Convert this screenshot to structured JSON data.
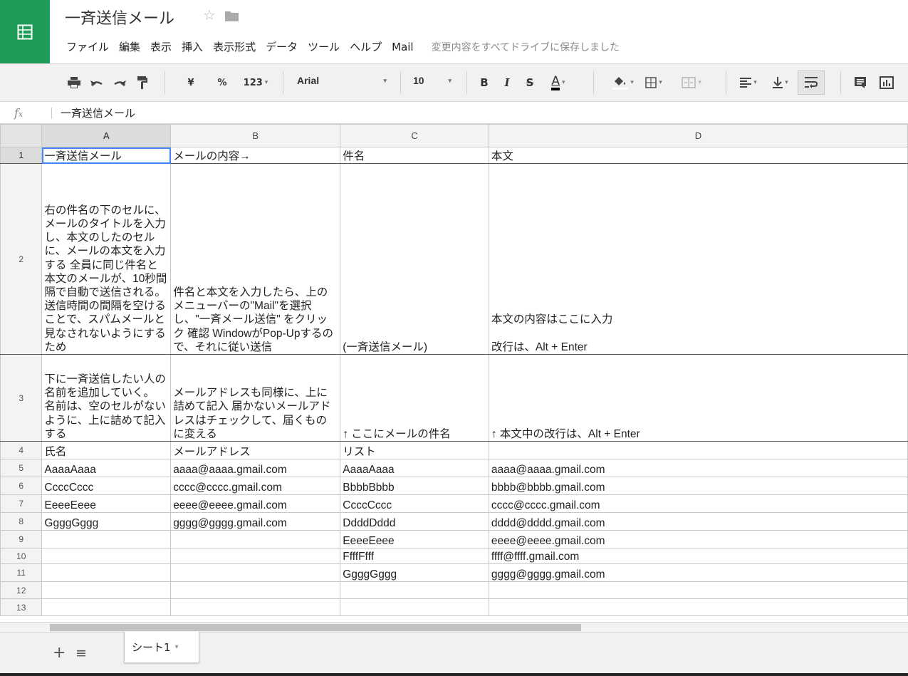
{
  "header": {
    "doc_title": "一斉送信メール",
    "star_icon": "☆",
    "folder_icon": "folder-icon",
    "menu": [
      "ファイル",
      "編集",
      "表示",
      "挿入",
      "表示形式",
      "データ",
      "ツール",
      "ヘルプ",
      "Mail"
    ],
    "save_status": "変更内容をすべてドライブに保存しました",
    "brand_color": "#1d9d57"
  },
  "toolbar": {
    "currency": "¥",
    "percent": "%",
    "number_format": "123",
    "font": "Arial",
    "font_size": "10",
    "bold": "B",
    "italic": "I",
    "strike": "S",
    "text_color": "A"
  },
  "formula_bar": {
    "fx": "fx",
    "value": "一斉送信メール"
  },
  "columns": [
    "A",
    "B",
    "C",
    "D"
  ],
  "rows": [
    {
      "num": "1",
      "cells": [
        "一斉送信メール",
        "メールの内容→",
        "件名",
        "本文"
      ]
    },
    {
      "num": "2",
      "cells": [
        "右の件名の下のセルに、メールのタイトルを入力し、本文のしたのセルに、メールの本文を入力する 全員に同じ件名と本文のメールが、10秒間隔で自動で送信される。 送信時間の間隔を空けることで、スパムメールと見なされないようにするため",
        "件名と本文を入力したら、上のメニューバーの\"Mail\"を選択し、\"一斉メール送信\" をクリック 確認 WindowがPop-Upするので、それに従い送信",
        "(一斉送信メール)",
        "本文の内容はここに入力\n\n改行は、Alt + Enter"
      ]
    },
    {
      "num": "3",
      "cells": [
        "下に一斉送信したい人の名前を追加していく。 名前は、空のセルがないように、上に詰めて記入する",
        "メールアドレスも同様に、上に詰めて記入 届かないメールアドレスはチェックして、届くものに変える",
        "↑ ここにメールの件名",
        "↑ 本文中の改行は、Alt + Enter"
      ]
    },
    {
      "num": "4",
      "cells": [
        "氏名",
        "メールアドレス",
        "リスト",
        ""
      ]
    },
    {
      "num": "5",
      "cells": [
        "AaaaAaaa",
        "aaaa@aaaa.gmail.com",
        "AaaaAaaa",
        "aaaa@aaaa.gmail.com"
      ]
    },
    {
      "num": "6",
      "cells": [
        "CcccCccc",
        "cccc@cccc.gmail.com",
        "BbbbBbbb",
        "bbbb@bbbb.gmail.com"
      ]
    },
    {
      "num": "7",
      "cells": [
        "EeeeEeee",
        "eeee@eeee.gmail.com",
        "CcccCccc",
        "cccc@cccc.gmail.com"
      ]
    },
    {
      "num": "8",
      "cells": [
        "GgggGggg",
        "gggg@gggg.gmail.com",
        "DdddDddd",
        "dddd@dddd.gmail.com"
      ]
    },
    {
      "num": "9",
      "cells": [
        "",
        "",
        "EeeeEeee",
        "eeee@eeee.gmail.com"
      ]
    },
    {
      "num": "10",
      "cells": [
        "",
        "",
        "FfffFfff",
        "ffff@ffff.gmail.com"
      ]
    },
    {
      "num": "11",
      "cells": [
        "",
        "",
        "GgggGggg",
        "gggg@gggg.gmail.com"
      ]
    },
    {
      "num": "12",
      "cells": [
        "",
        "",
        "",
        ""
      ]
    },
    {
      "num": "13",
      "cells": [
        "",
        "",
        "",
        ""
      ]
    }
  ],
  "tabs": {
    "add": "+",
    "all_sheets": "≡",
    "sheet_name": "シート1",
    "caret": "▾"
  }
}
